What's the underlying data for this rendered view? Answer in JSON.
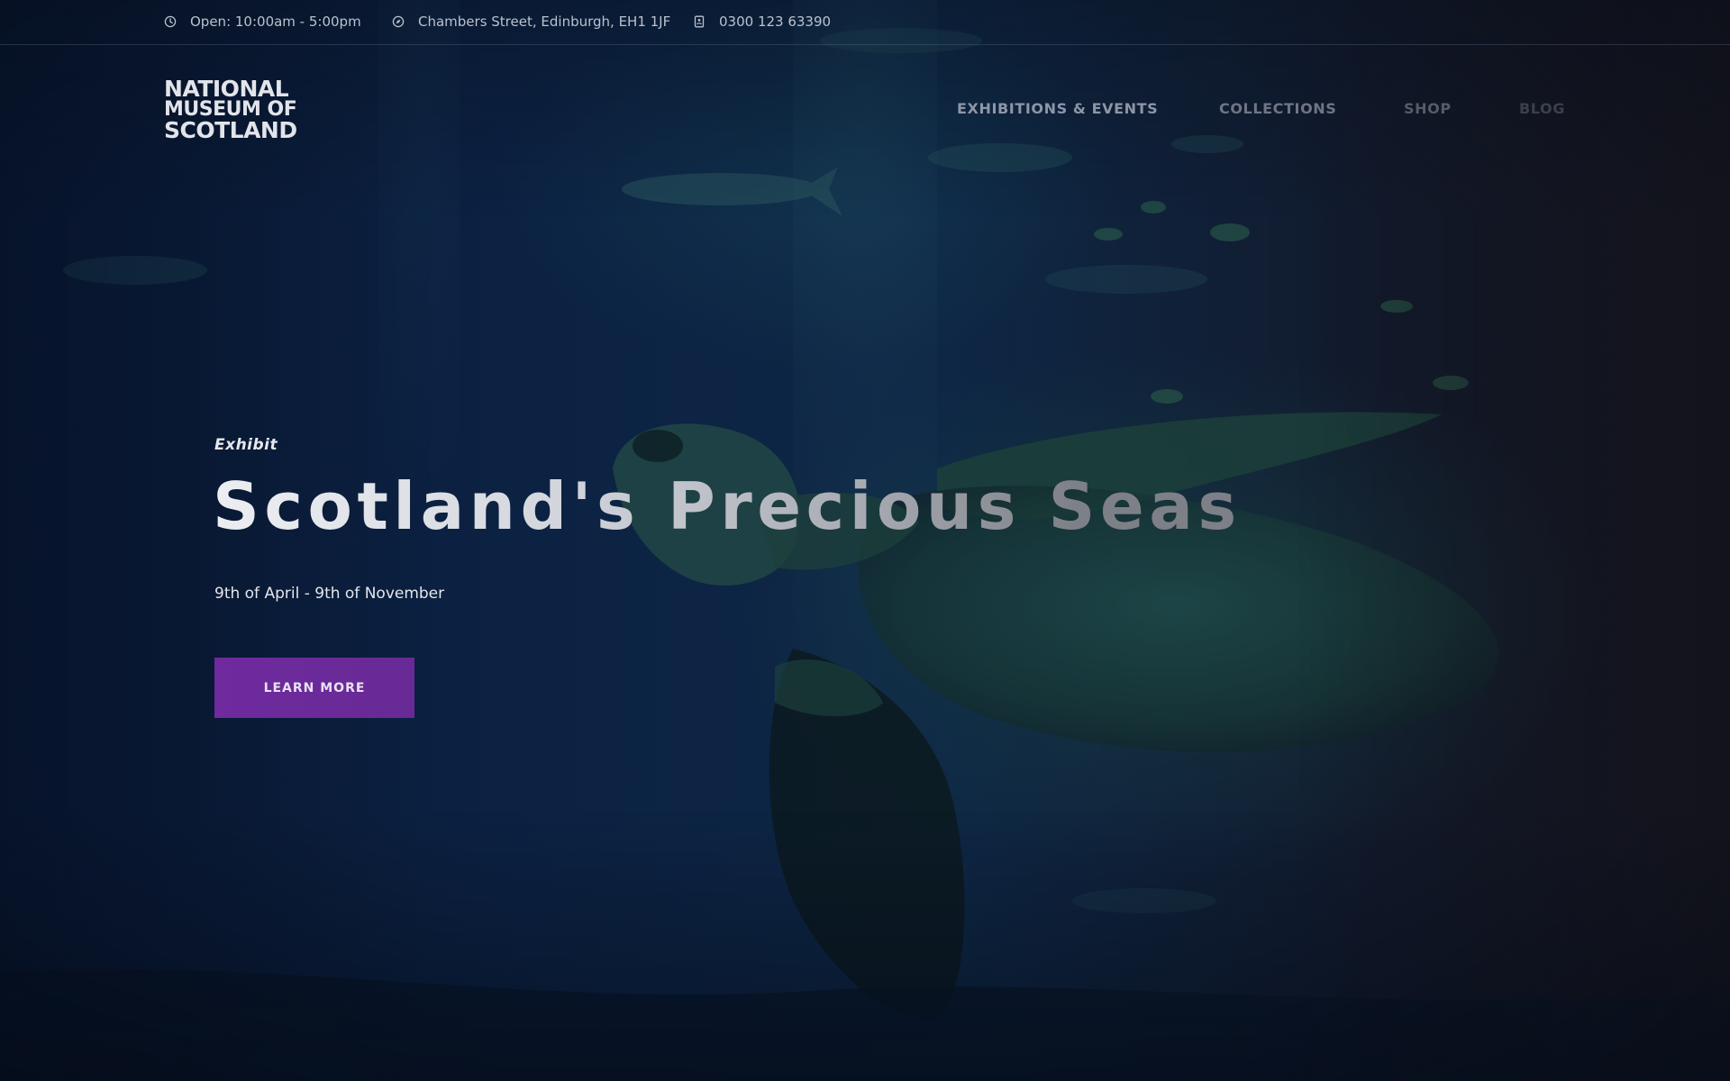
{
  "topbar": {
    "hours": {
      "icon": "clock-icon",
      "text": "Open: 10:00am - 5:00pm"
    },
    "address": {
      "icon": "compass-icon",
      "text": "Chambers Street, Edinburgh, EH1 1JF"
    },
    "phone": {
      "icon": "phone-icon",
      "text": "0300 123 63390"
    }
  },
  "header": {
    "logo": {
      "line1": "NATIONAL",
      "line2": "MUSEUM OF",
      "line3": "SCOTLAND"
    },
    "nav": [
      {
        "label": "EXHIBITIONS & EVENTS"
      },
      {
        "label": "COLLECTIONS"
      },
      {
        "label": "SHOP"
      },
      {
        "label": "BLOG"
      }
    ]
  },
  "hero": {
    "eyebrow": "Exhibit",
    "title": "Scotland's Precious Seas",
    "dates": "9th of April - 9th of November",
    "cta_label": "LEARN MORE",
    "background": "underwater-sea-turtle-photo"
  },
  "colors": {
    "accent": "#6f2a9e",
    "background": "#0c2243",
    "text_light": "#e4e6ec"
  }
}
